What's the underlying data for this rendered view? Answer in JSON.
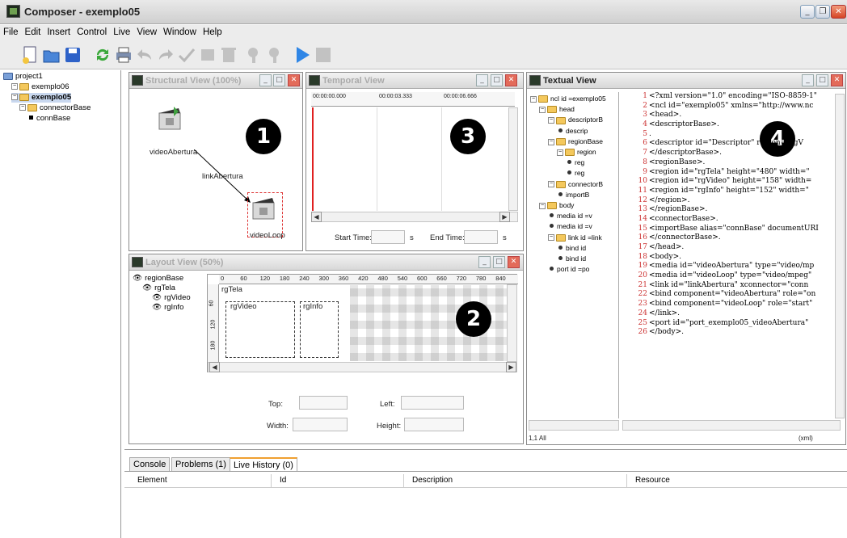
{
  "window": {
    "title": "Composer - exemplo05"
  },
  "menu": [
    "File",
    "Edit",
    "Insert",
    "Control",
    "Live",
    "View",
    "Window",
    "Help"
  ],
  "toolbar": {
    "icons": [
      "new-document-icon",
      "open-folder-icon",
      "save-icon",
      "refresh-icon",
      "print-icon",
      "undo-icon",
      "redo-icon",
      "check-icon",
      "cut-icon",
      "delete-icon",
      "zoom-out-icon",
      "zoom-in-icon",
      "play-icon",
      "stop-icon"
    ]
  },
  "project_tree": [
    {
      "label": "project1",
      "indent": 0,
      "icon": "project"
    },
    {
      "label": "exemplo06",
      "indent": 1,
      "icon": "folder"
    },
    {
      "label": "exemplo05",
      "indent": 1,
      "icon": "folder",
      "bold": true
    },
    {
      "label": "connectorBase",
      "indent": 2,
      "icon": "folder"
    },
    {
      "label": "connBase",
      "indent": 3,
      "icon": "leaf"
    }
  ],
  "structural": {
    "title": "Structural View (100%)",
    "node1": "videoAbertura",
    "node2": "videoLoop",
    "link": "linkAbertura",
    "badge": "1"
  },
  "temporal": {
    "title": "Temporal View",
    "ticks": [
      "00:00:00.000",
      "00:00:03.333",
      "00:00:06.666"
    ],
    "start_label": "Start Time:",
    "end_label": "End Time:",
    "unit": "s",
    "badge": "3"
  },
  "layout": {
    "title": "Layout View (50%)",
    "tree": [
      "regionBase",
      "rgTela",
      "rgVideo",
      "rgInfo"
    ],
    "ruler": [
      "0",
      "60",
      "120",
      "180",
      "240",
      "300",
      "360",
      "420",
      "480",
      "540",
      "600",
      "660",
      "720",
      "780",
      "840"
    ],
    "region_main": "rgTela",
    "region_video": "rgVideo",
    "region_info": "rgInfo",
    "vruler": [
      "60",
      "120",
      "180"
    ],
    "top_label": "Top:",
    "left_label": "Left:",
    "width_label": "Width:",
    "height_label": "Height:",
    "badge": "2"
  },
  "textual": {
    "title": "Textual View",
    "badge": "4",
    "status": "1,1 All",
    "mode": "(xml)",
    "outline": [
      {
        "t": "ncl id =exemplo05",
        "i": 0,
        "f": true
      },
      {
        "t": "head",
        "i": 1,
        "f": true
      },
      {
        "t": "descriptorB",
        "i": 2,
        "f": true
      },
      {
        "t": "descrip",
        "i": 3,
        "f": false
      },
      {
        "t": "regionBase",
        "i": 2,
        "f": true
      },
      {
        "t": "region",
        "i": 3,
        "f": true
      },
      {
        "t": "reg",
        "i": 4,
        "f": false
      },
      {
        "t": "reg",
        "i": 4,
        "f": false
      },
      {
        "t": "connectorB",
        "i": 2,
        "f": true
      },
      {
        "t": "importB",
        "i": 3,
        "f": false
      },
      {
        "t": "body",
        "i": 1,
        "f": true
      },
      {
        "t": "media id =v",
        "i": 2,
        "f": false
      },
      {
        "t": "media id =v",
        "i": 2,
        "f": false
      },
      {
        "t": "link id =link",
        "i": 2,
        "f": true
      },
      {
        "t": "bind id",
        "i": 3,
        "f": false
      },
      {
        "t": "bind id",
        "i": 3,
        "f": false
      },
      {
        "t": "port id =po",
        "i": 2,
        "f": false
      }
    ],
    "code": [
      "<?xml version=\"1.0\" encoding=\"ISO-8859-1\"",
      "<ncl id=\"exemplo05\" xmlns=\"http://www.nc",
      "<head>.",
      "<descriptorBase>.",
      ".",
      "<descriptor id=\"Descriptor\" region=\"rgV",
      "</descriptorBase>.",
      "<regionBase>.",
      "<region id=\"rgTela\" height=\"480\" width=\"",
      "<region id=\"rgVideo\" height=\"158\" width=",
      "<region id=\"rgInfo\" height=\"152\" width=\"",
      "</region>.",
      "</regionBase>.",
      "<connectorBase>.",
      "<importBase alias=\"connBase\" documentURI",
      "</connectorBase>.",
      "</head>.",
      "<body>.",
      "<media id=\"videoAbertura\" type=\"video/mp",
      "<media id=\"videoLoop\" type=\"video/mpeg\"",
      "<link id=\"linkAbertura\" xconnector=\"conn",
      "<bind component=\"videoAbertura\" role=\"on",
      "<bind component=\"videoLoop\" role=\"start\"",
      "</link>.",
      "<port id=\"port_exemplo05_videoAbertura\"",
      "</body>."
    ]
  },
  "bottom": {
    "tabs": [
      "Console",
      "Problems (1)",
      "Live History (0)"
    ],
    "columns": [
      "Element",
      "Id",
      "Description",
      "Resource"
    ]
  }
}
